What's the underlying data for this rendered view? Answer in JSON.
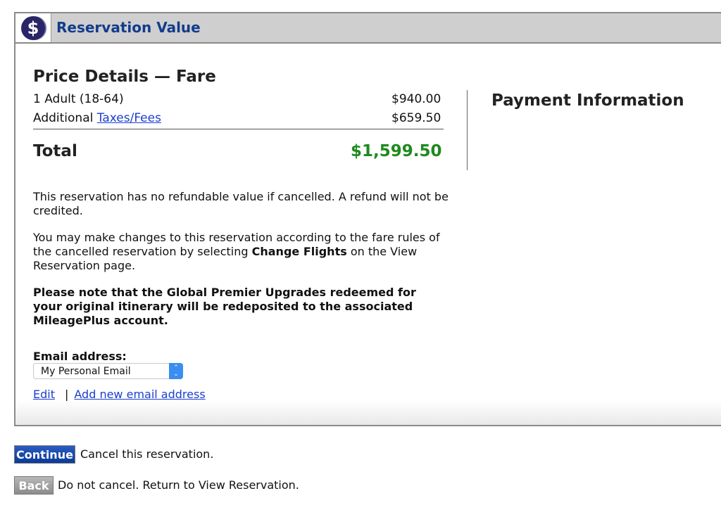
{
  "header": {
    "title": "Reservation Value",
    "icon": "dollar-icon"
  },
  "price": {
    "title": "Price Details — Fare",
    "rows": [
      {
        "label": "1 Adult (18-64)",
        "amount": "$940.00"
      },
      {
        "label": "Additional ",
        "link": "Taxes/Fees",
        "amount": "$659.50"
      }
    ],
    "total_label": "Total",
    "total_amount": "$1,599.50",
    "total_color": "#1e8a1e"
  },
  "payment": {
    "title": "Payment Information"
  },
  "notes": {
    "refund": "This reservation has no refundable value if cancelled. A refund will not be credited.",
    "changes_pre": "You may make changes to this reservation according to the fare rules of the cancelled reservation by selecting ",
    "changes_bold": "Change Flights",
    "changes_post": " on the View Reservation page.",
    "upgrades": "Please note that the Global Premier Upgrades redeemed for your original itinerary will be redeposited to the associated MileagePlus account."
  },
  "email": {
    "label": "Email address:",
    "selected": "My Personal Email",
    "edit": "Edit",
    "separator": "|",
    "add": "Add new email address"
  },
  "actions": {
    "continue": "Continue",
    "continue_desc": "Cancel this reservation.",
    "back": "Back",
    "back_desc": "Do not cancel. Return to View Reservation."
  }
}
